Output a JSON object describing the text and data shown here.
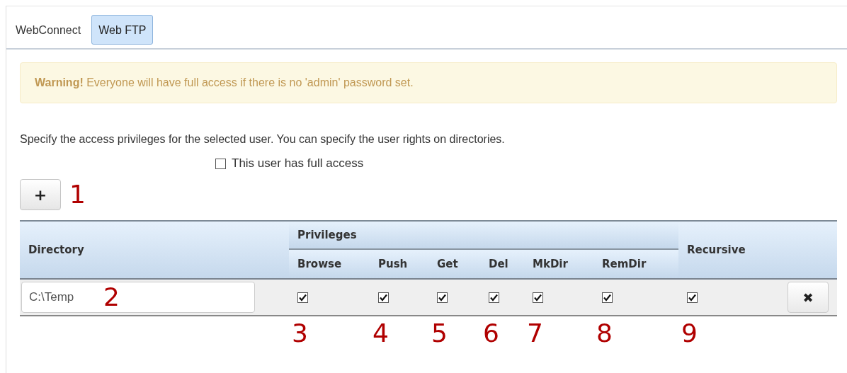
{
  "tabs": [
    {
      "label": "WebConnect",
      "selected": false
    },
    {
      "label": "Web FTP",
      "selected": true
    }
  ],
  "warning": {
    "label": "Warning!",
    "text": "Everyone will have full access if there is no 'admin' password set."
  },
  "description": "Specify the access privileges for the selected user. You can specify the user rights on directories.",
  "full_access": {
    "label": "This user has full access",
    "checked": false
  },
  "add_button": {
    "label": "+",
    "callout": "1"
  },
  "table": {
    "directory_header": "Directory",
    "privileges_header": "Privileges",
    "recursive_header": "Recursive",
    "privilege_columns": [
      "Browse",
      "Push",
      "Get",
      "Del",
      "MkDir",
      "RemDir"
    ],
    "rows": [
      {
        "directory": "C:\\Temp",
        "directory_callout": "2",
        "privileges": [
          {
            "checked": true,
            "callout": "3"
          },
          {
            "checked": true,
            "callout": "4"
          },
          {
            "checked": true,
            "callout": "5"
          },
          {
            "checked": true,
            "callout": "6"
          },
          {
            "checked": true,
            "callout": "7"
          },
          {
            "checked": true,
            "callout": "8"
          }
        ],
        "recursive": {
          "checked": true,
          "callout": "9"
        },
        "delete_label": "✖"
      }
    ]
  }
}
